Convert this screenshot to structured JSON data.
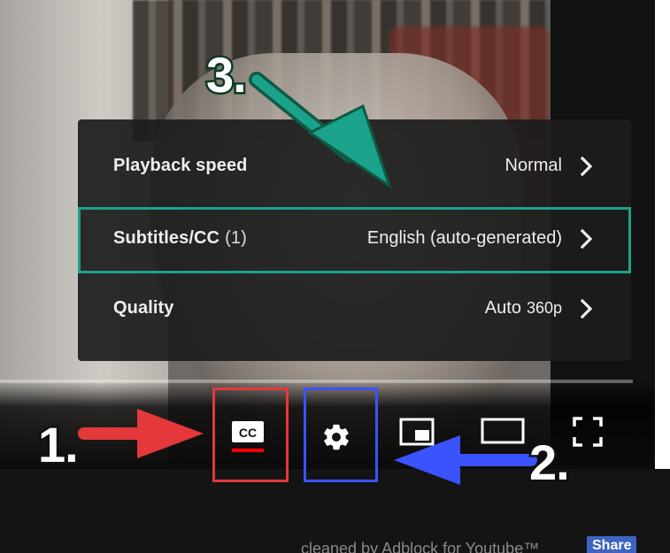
{
  "menu": {
    "rows": [
      {
        "label": "Playback speed",
        "count": "",
        "value": "Normal",
        "value_small": ""
      },
      {
        "label": "Subtitles/CC",
        "count": "(1)",
        "value": "English (auto-generated)",
        "value_small": ""
      },
      {
        "label": "Quality",
        "count": "",
        "value": "Auto",
        "value_small": "360p"
      }
    ]
  },
  "controls": {
    "cc_text": "CC"
  },
  "annotations": {
    "one": "1.",
    "two": "2.",
    "three": "3.",
    "colors": {
      "red": "#e4383a",
      "blue": "#3b52ff",
      "green": "#1aa38a"
    }
  },
  "footer": {
    "text": "cleaned by Adblock for Youtube™",
    "share": "Share"
  },
  "icons": {
    "chevron": "chevron-right-icon",
    "cc": "closed-captions-icon",
    "gear": "gear-icon",
    "pip": "miniplayer-icon",
    "theater": "theater-mode-icon",
    "fullscreen": "fullscreen-icon"
  }
}
